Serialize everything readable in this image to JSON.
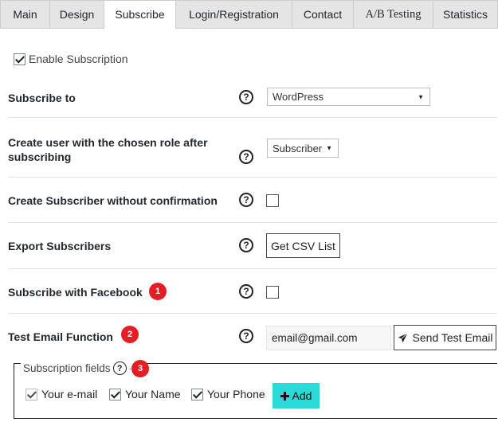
{
  "tabs": [
    {
      "label": "Main",
      "active": false
    },
    {
      "label": "Design",
      "active": false
    },
    {
      "label": "Subscribe",
      "active": true
    },
    {
      "label": "Login/Registration",
      "active": false
    },
    {
      "label": "Contact",
      "active": false
    },
    {
      "label": "A/B Testing",
      "active": false
    },
    {
      "label": "Statistics",
      "active": false
    }
  ],
  "enable_subscription": {
    "label": "Enable Subscription",
    "checked": true
  },
  "subscribe_to": {
    "label": "Subscribe to",
    "value": "WordPress"
  },
  "create_user": {
    "label_line1": "Create user with the chosen role after",
    "label_line2": "subscribing",
    "value": "Subscriber"
  },
  "without_confirmation": {
    "label": "Create Subscriber without confirmation",
    "checked": false
  },
  "export": {
    "label": "Export Subscribers",
    "button_label": "Get CSV List"
  },
  "facebook": {
    "label": "Subscribe with Facebook",
    "checked": false,
    "badge": "1"
  },
  "test_email": {
    "label": "Test Email Function",
    "value": "email@gmail.com",
    "button_label": "Send Test Email",
    "badge": "2"
  },
  "subscription_fields": {
    "legend": "Subscription fields",
    "badge": "3",
    "items": [
      {
        "label": "Your e-mail",
        "checked": true,
        "disabled": true
      },
      {
        "label": "Your Name",
        "checked": true,
        "disabled": false
      },
      {
        "label": "Your Phone",
        "checked": true,
        "disabled": false
      }
    ],
    "add_label": "Add"
  },
  "help_glyph": "?",
  "colors": {
    "badge": "#e31e24",
    "add_button": "#2cd9d9",
    "tab_inactive": "#e5e5e5"
  }
}
